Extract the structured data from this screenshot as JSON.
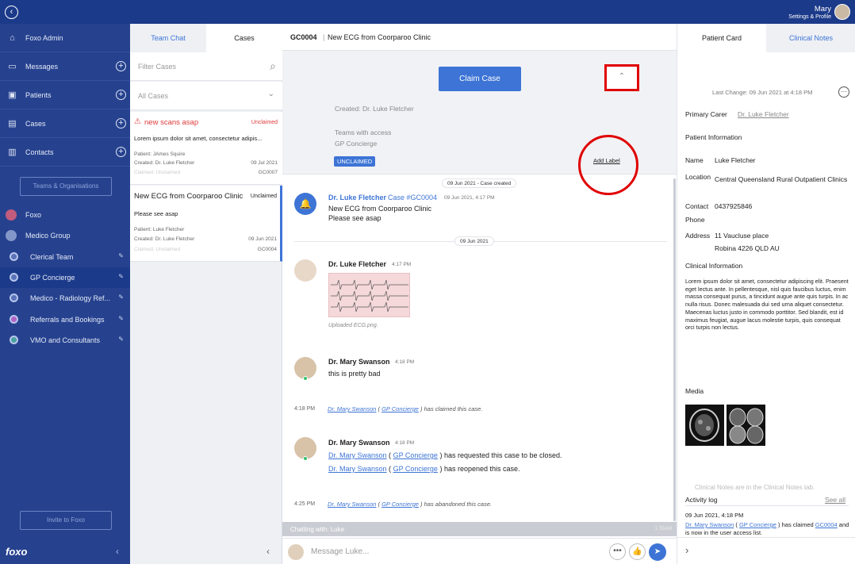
{
  "topbar": {
    "user_name": "Mary",
    "user_sub": "Settings & Profile"
  },
  "sidebar": {
    "items": [
      {
        "label": "Foxo Admin",
        "icon": "home-icon",
        "plus": false
      },
      {
        "label": "Messages",
        "icon": "messages-icon",
        "plus": true
      },
      {
        "label": "Patients",
        "icon": "id-card-icon",
        "plus": true
      },
      {
        "label": "Cases",
        "icon": "clipboard-icon",
        "plus": true
      },
      {
        "label": "Contacts",
        "icon": "contacts-icon",
        "plus": true
      }
    ],
    "teams_button": "Teams & Organisations",
    "groups": [
      {
        "label": "Foxo"
      },
      {
        "label": "Medico Group"
      }
    ],
    "subgroups": [
      {
        "label": "Clerical Team"
      },
      {
        "label": "GP Concierge"
      },
      {
        "label": "Medico - Radiology Ref..."
      },
      {
        "label": "Referrals and Bookings"
      },
      {
        "label": "VMO and Consultants"
      }
    ],
    "invite_button": "Invite to Foxo",
    "logo": "foxo"
  },
  "casepanel": {
    "tabs": [
      {
        "label": "Team Chat"
      },
      {
        "label": "Cases"
      }
    ],
    "filter_placeholder": "Filter Cases",
    "all_cases": "All Cases",
    "cards": [
      {
        "title": "new scans asap",
        "status": "Unclaimed",
        "body": "Lorem ipsum dolor sit amet, consectetur adipis...",
        "patient": "Patient: JAmes Squire",
        "created": "Created: Dr. Luke Fletcher",
        "date": "09 Jul 2021",
        "claimed": "Claimed: Unclaimed",
        "id": "GC0007"
      },
      {
        "title": "New ECG from Coorparoo Clinic",
        "status": "Unclaimed",
        "body": "Please see asap",
        "patient": "Patient: Luke Fletcher",
        "created": "Created: Dr. Luke Fletcher",
        "date": "09 Jun 2021",
        "claimed": "Claimed: Unclaimed",
        "id": "GC0004"
      }
    ]
  },
  "main": {
    "case_id": "GC0004",
    "case_title": "New ECG from Coorparoo Clinic",
    "claim_button": "Claim Case",
    "created": "Created: Dr. Luke Fletcher",
    "teams_access_label": "Teams with access",
    "teams_access_value": "GP Concierge",
    "status_badge": "UNCLAIMED",
    "add_label": "Add Label",
    "pill_created": "09 Jun 2021 - Case created",
    "case_msg": {
      "name": "Dr. Luke Fletcher",
      "case_ref": "Case #GC0004",
      "time": "09 Jun 2021, 4:17 PM",
      "line1": "New ECG from Coorparoo Clinic",
      "line2": "Please see asap"
    },
    "date_pill": "09 Jun 2021",
    "msg1": {
      "name": "Dr. Luke Fletcher",
      "time": "4:17 PM",
      "caption": "Uploaded ECG.png."
    },
    "msg2": {
      "name": "Dr. Mary Swanson",
      "time": "4:18 PM",
      "text": "this is pretty bad"
    },
    "sys1": {
      "time": "4:18 PM",
      "user": "Dr. Mary Swanson",
      "team": "GP Concierge",
      "open": "(",
      "close": ")",
      "action": "has claimed this case."
    },
    "msg3": {
      "name": "Dr. Mary Swanson",
      "time": "4:18 PM",
      "user": "Dr. Mary Swanson",
      "team": "GP Concierge",
      "open": "(",
      "close": ")",
      "line1": "has requested this case to be closed.",
      "line2": "has reopened this case."
    },
    "sys2": {
      "time": "4:25 PM",
      "user": "Dr. Mary Swanson",
      "team": "GP Concierge",
      "open": "(",
      "close": ")",
      "action": "has abandoned this case."
    },
    "chatting_with": "Chatting with: Luke",
    "chatting_right": "1 TEAM",
    "message_placeholder": "Message Luke..."
  },
  "right": {
    "tabs": [
      {
        "label": "Patient Card"
      },
      {
        "label": "Clinical Notes"
      }
    ],
    "last_change": "Last Change: 09 Jun 2021 at 4:18 PM",
    "primary_carer_label": "Primary Carer",
    "primary_carer_value": "Dr. Luke Fletcher",
    "patient_info": "Patient Information",
    "name_label": "Name",
    "name_value": "Luke Fletcher",
    "location_label": "Location",
    "location_value": "Central Queensland Rural Outpatient Clinics",
    "contact_label": "Contact",
    "contact_value": "0437925846",
    "phone_label": "Phone",
    "address_label": "Address",
    "address_line1": "11 Vaucluse place",
    "address_line2": "Robina 4226 QLD AU",
    "clinical_info": "Clinical Information",
    "clinical_text": "Lorem ipsum dolor sit amet, consectetur adipiscing elit. Praesent eget lectus ante. In pellentesque, nisl quis faucibus luctus, enim massa consequat purus, a tincidunt augue ante quis turpis. In ac nulla risus. Donec malesuada dui sed urna aliquet consectetur. Maecenas luctus justo in commodo porttitor. Sed blandit, est id maximus feugiat, augue lacus molestie turpis, quis consequat orci turpis non lectus.",
    "media": "Media",
    "clinical_notes_hint": "Clinical Notes are in the Clinical Notes tab.",
    "activity_log": "Activity log",
    "see_all": "See all",
    "log_time": "09 Jun 2021, 4:18 PM",
    "log_user": "Dr. Mary Swanson",
    "log_team": "GP Concierge",
    "log_open": "(",
    "log_close": ")",
    "log_action": "has claimed",
    "log_case": "GC0004",
    "log_rest": "and is now in the user access list."
  },
  "colors": {
    "navy": "#1c3a8a",
    "sidebar": "#26428f",
    "accent": "#3d74d6",
    "alert": "#e03a3a",
    "highlight": "#e00000"
  }
}
